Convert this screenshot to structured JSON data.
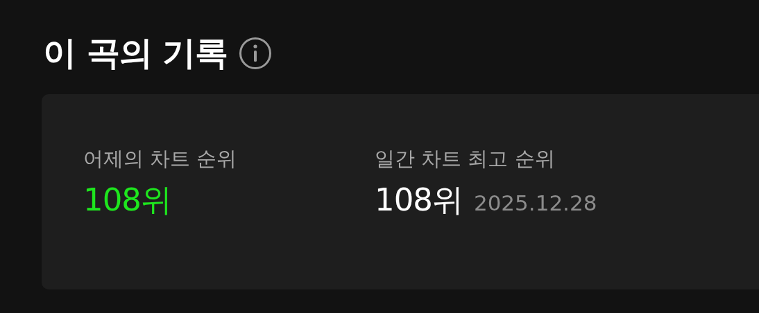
{
  "section": {
    "title": "이 곡의 기록"
  },
  "stats": [
    {
      "label": "어제의 차트 순위",
      "value": "108위",
      "highlighted": true
    },
    {
      "label": "일간 차트 최고 순위",
      "value": "108위",
      "date": "2025.12.28",
      "highlighted": false
    }
  ]
}
